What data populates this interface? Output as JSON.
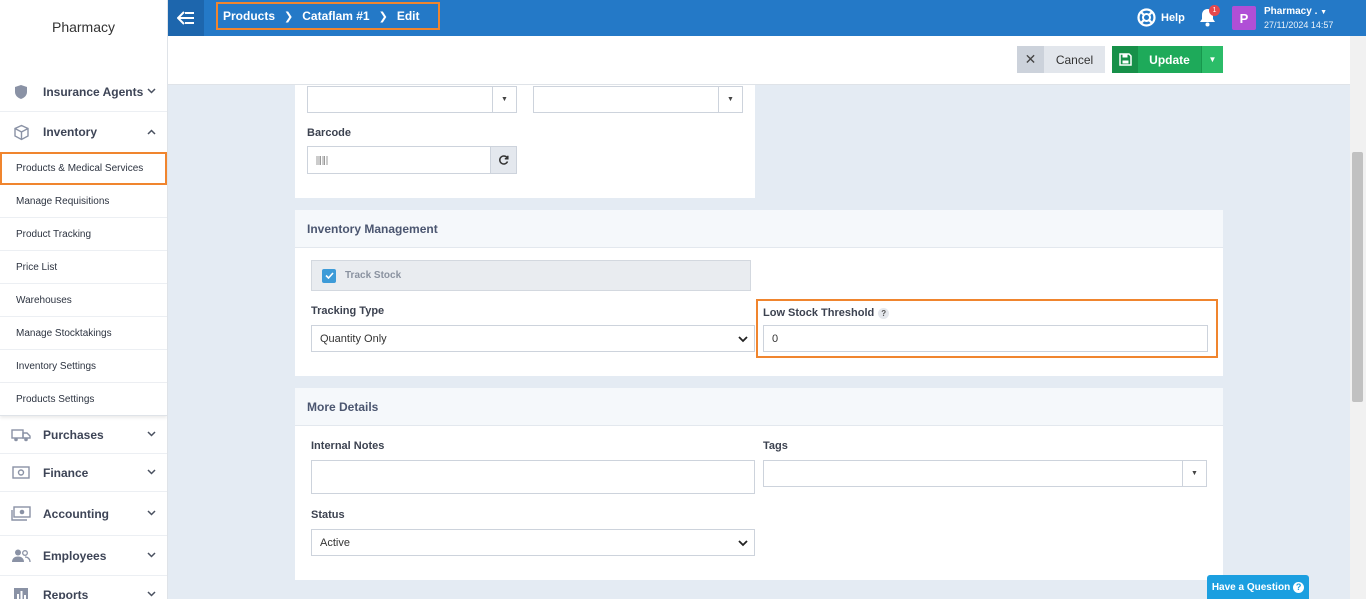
{
  "sidebar": {
    "brand": "Pharmacy",
    "top_items": [
      {
        "label": "Insurance Agents"
      },
      {
        "label": "Inventory"
      }
    ],
    "sub_items": [
      {
        "label": "Products & Medical Services"
      },
      {
        "label": "Manage Requisitions"
      },
      {
        "label": "Product Tracking"
      },
      {
        "label": "Price List"
      },
      {
        "label": "Warehouses"
      },
      {
        "label": "Manage Stocktakings"
      },
      {
        "label": "Inventory Settings"
      },
      {
        "label": "Products Settings"
      }
    ],
    "bottom_items": [
      {
        "label": "Purchases"
      },
      {
        "label": "Finance"
      },
      {
        "label": "Accounting"
      },
      {
        "label": "Employees"
      },
      {
        "label": "Reports"
      }
    ]
  },
  "topbar": {
    "breadcrumb": [
      "Products",
      "Cataflam #1",
      "Edit"
    ],
    "help_label": "Help",
    "notification_count": "1",
    "avatar_letter": "P",
    "user_name": "Pharmacy .",
    "user_datetime": "27/11/2024 14:57"
  },
  "actions": {
    "cancel_label": "Cancel",
    "update_label": "Update"
  },
  "basic_panel": {
    "barcode_label": "Barcode"
  },
  "inventory_panel": {
    "title": "Inventory Management",
    "track_stock_label": "Track Stock",
    "tracking_type_label": "Tracking Type",
    "tracking_type_value": "Quantity Only",
    "low_stock_label": "Low Stock Threshold",
    "low_stock_value": "0"
  },
  "details_panel": {
    "title": "More Details",
    "internal_notes_label": "Internal Notes",
    "tags_label": "Tags",
    "status_label": "Status",
    "status_value": "Active"
  },
  "have_question": "Have a Question",
  "colors": {
    "topbar": "#2479c7",
    "highlight": "#f0852e",
    "update": "#1eaa5a"
  }
}
